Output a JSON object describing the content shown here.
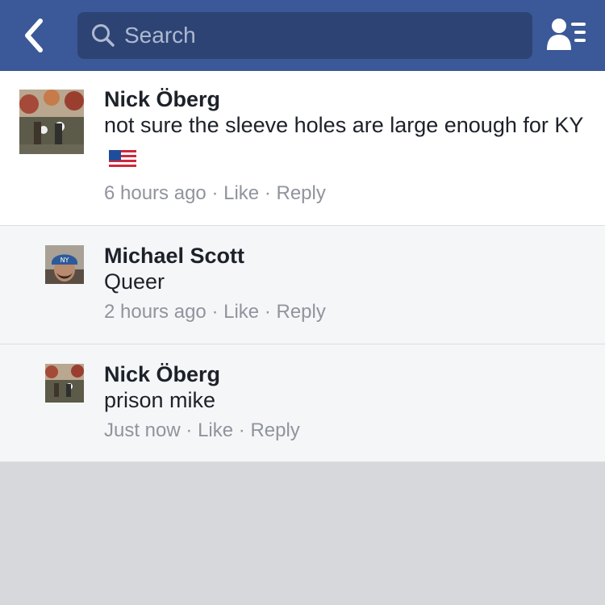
{
  "header": {
    "search_placeholder": "Search"
  },
  "comments": [
    {
      "author": "Nick Öberg",
      "text": "not sure the sleeve holes are large enough for KY",
      "time": "6 hours ago",
      "like_label": "Like",
      "reply_label": "Reply"
    },
    {
      "author": "Michael Scott",
      "text": "Queer",
      "time": "2 hours ago",
      "like_label": "Like",
      "reply_label": "Reply"
    },
    {
      "author": "Nick Öberg",
      "text": "prison mike",
      "time": "Just now",
      "like_label": "Like",
      "reply_label": "Reply"
    }
  ],
  "separator": "·",
  "icons": {
    "back": "back-chevron-icon",
    "search": "magnifier-icon",
    "friends": "friends-list-icon",
    "flag": "us-flag-emoji"
  },
  "colors": {
    "brand": "#3b5998",
    "search_bg": "#2d4373",
    "text": "#1d2129",
    "meta": "#90949c"
  }
}
